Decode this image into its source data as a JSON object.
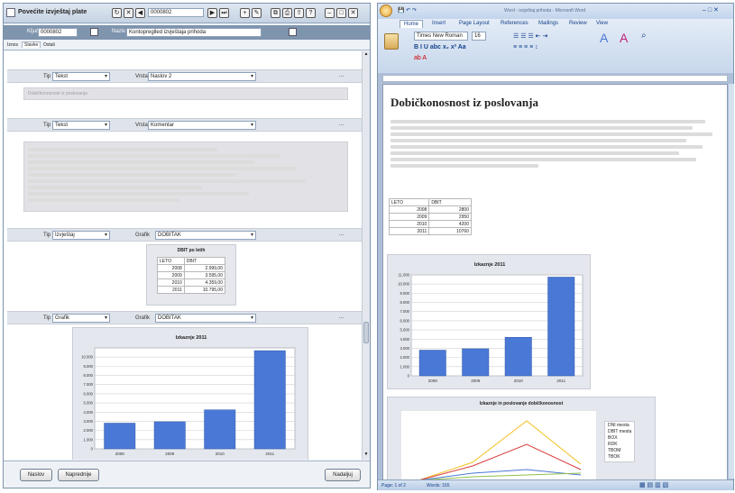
{
  "left_app": {
    "title": "Povećite izvještaj plate",
    "id_label": "Ključ",
    "id_value": "0000802",
    "name_label": "Naziv",
    "name_value": "Kontopreglled izvještaja prihoda",
    "tabs": [
      "Iznos",
      "Stavke",
      "Ostali"
    ],
    "sections": [
      {
        "type_label": "Tip",
        "type_value": "Tekst",
        "kind_label": "Vrsta",
        "kind_value": "Naslov 2",
        "dots": "...",
        "body": "Dobičkonosnost iz poslovanja"
      },
      {
        "type_label": "Tip",
        "type_value": "Tekst",
        "kind_label": "Vrsta",
        "kind_value": "Komentar",
        "dots": "..."
      },
      {
        "type_label": "Tip",
        "type_value": "Izvještaj",
        "kind_label": "Grafik",
        "kind_value": "DOBITAK",
        "dots": "..."
      },
      {
        "type_label": "Tip",
        "type_value": "Grafik",
        "kind_label": "Grafik",
        "kind_value": "DOBITAK",
        "dots": "..."
      }
    ],
    "table_title": "DBIT po letih",
    "table_headers": [
      "LETO",
      "DBIT"
    ],
    "table_rows": [
      [
        "2008",
        "2.999,00"
      ],
      [
        "2009",
        "3.595,00"
      ],
      [
        "2010",
        "4.359,00"
      ],
      [
        "2011",
        "10.795,00"
      ]
    ],
    "chart_title": "Izkaznje 2011",
    "buttons": {
      "first": "Naslov",
      "second": "Naprednije",
      "third": "Nadaljuj"
    }
  },
  "right_app": {
    "title": "Word - izvještaj prihoda - Microsoft Word",
    "tabs": [
      "Home",
      "Insert",
      "Page Layout",
      "References",
      "Mailings",
      "Review",
      "View"
    ],
    "font_name": "Times New Roman",
    "font_size": "16",
    "doc_heading": "Dobičkonosnost iz poslovanja",
    "doc_table_headers": [
      "LETO",
      "DBIT"
    ],
    "doc_table_rows": [
      [
        "2008",
        "2800"
      ],
      [
        "2009",
        "2950"
      ],
      [
        "2010",
        "4200"
      ],
      [
        "2011",
        "10760"
      ]
    ],
    "chart_title": "Izkaznje 2011",
    "chart2_title": "Izkaznje in poslovanje dobičkonosnost",
    "legend": [
      "DNI mesta",
      "DBIT mesta",
      "BOX",
      "RDK",
      "TBOM",
      "TBOK"
    ],
    "status_page": "Page: 1 of 2",
    "status_words": "Words: 165"
  },
  "colors": {
    "bar": "#4a78d6",
    "accent": "#15428b",
    "gray_box": "#e2e2e6"
  },
  "chart_data": [
    {
      "type": "bar",
      "title": "Izkaznje 2011",
      "categories": [
        "2008",
        "2009",
        "2010",
        "2011"
      ],
      "values": [
        2800,
        2950,
        4250,
        10700
      ],
      "ylim": [
        0,
        11000
      ],
      "yticks": [
        "0",
        "1.000",
        "2.000",
        "3.000",
        "4.000",
        "5.000",
        "6.000",
        "7.000",
        "8.000",
        "9.000",
        "10.000"
      ],
      "grid": true,
      "xlabel": "",
      "ylabel": ""
    },
    {
      "type": "bar",
      "title": "Izkaznje 2011",
      "categories": [
        "2008",
        "2009",
        "2010",
        "2011"
      ],
      "values": [
        2800,
        2950,
        4200,
        10760
      ],
      "ylim": [
        0,
        11000
      ],
      "yticks": [
        "0",
        "1.000",
        "2.000",
        "3.000",
        "4.000",
        "5.000",
        "6.000",
        "7.000",
        "8.000",
        "9.000",
        "10.000",
        "11.000"
      ],
      "grid": true,
      "xlabel": "",
      "ylabel": ""
    }
  ]
}
